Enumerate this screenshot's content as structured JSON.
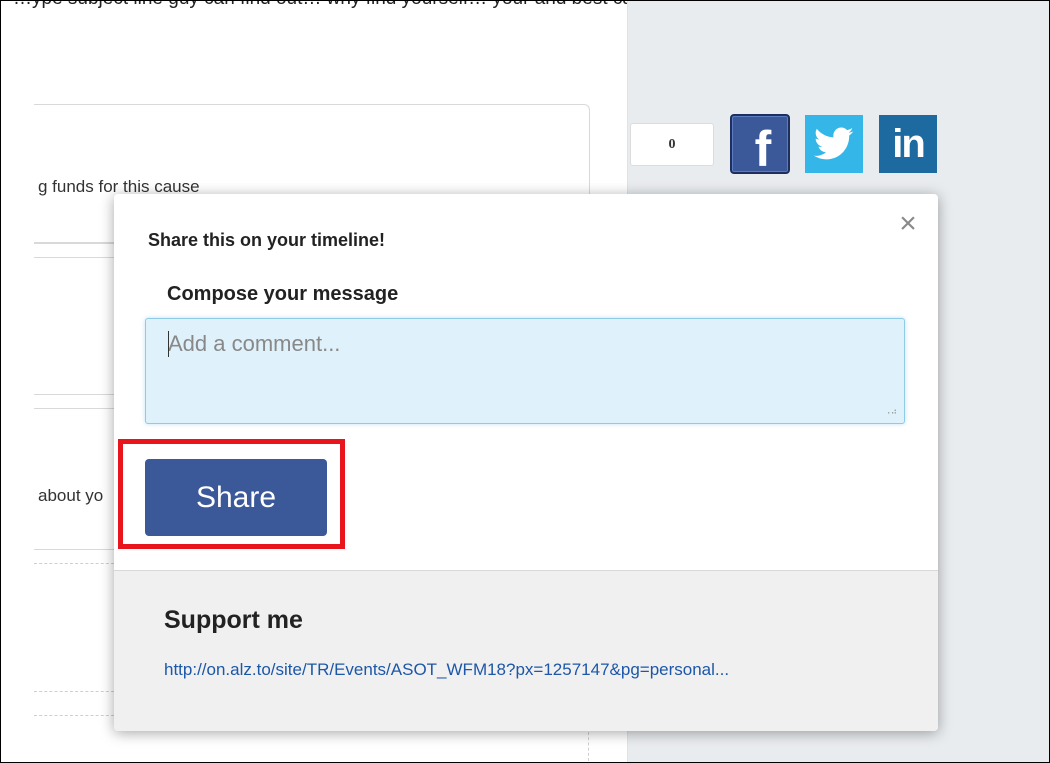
{
  "background": {
    "top_fragment": "…ype subject line guy can find out… why find yourself… your and best campaign",
    "card_text_1": "g funds for this cause",
    "card_text_2": "about yo"
  },
  "share_bar": {
    "count": "0",
    "facebook_glyph": "f",
    "linkedin_glyph": "in",
    "colors": {
      "facebook": "#3b5998",
      "twitter": "#34b7e8",
      "linkedin": "#1c6aa0"
    }
  },
  "popup": {
    "close_glyph": "×",
    "title": "Share this on your timeline!",
    "compose_label": "Compose your message",
    "comment_placeholder": "Add a comment...",
    "share_label": "Share",
    "footer": {
      "title": "Support me",
      "link": "http://on.alz.to/site/TR/Events/ASOT_WFM18?px=1257147&pg=personal..."
    }
  },
  "highlight_color": "#e8151d"
}
